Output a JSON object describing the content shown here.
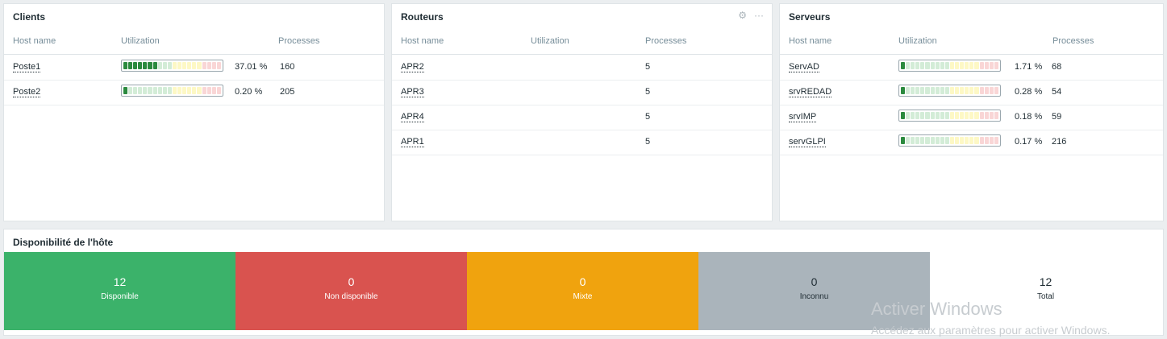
{
  "colors": {
    "available": "#3bb26a",
    "unavailable": "#d9534f",
    "mixed": "#f0a30e",
    "unknown": "#aab4bb",
    "seg_green_on": "#2b8a3e",
    "seg_green_off": "#d3ecd7",
    "seg_yellow_on": "#f0d64e",
    "seg_yellow_off": "#fdf8c5",
    "seg_red_on": "#e05252",
    "seg_red_off": "#f9d6d6"
  },
  "clients": {
    "title": "Clients",
    "col_host": "Host name",
    "col_util": "Utilization",
    "col_proc": "Processes",
    "rows": [
      {
        "host": "Poste1",
        "util_text": "37.01 %",
        "util": 0.3701,
        "proc": "160"
      },
      {
        "host": "Poste2",
        "util_text": "0.20 %",
        "util": 0.002,
        "proc": "205"
      }
    ]
  },
  "routeurs": {
    "title": "Routeurs",
    "gear_icon": "gear-icon",
    "menu_icon": "more-icon",
    "col_host": "Host name",
    "col_util": "Utilization",
    "col_proc": "Processes",
    "rows": [
      {
        "host": "APR2",
        "proc": "5"
      },
      {
        "host": "APR3",
        "proc": "5"
      },
      {
        "host": "APR4",
        "proc": "5"
      },
      {
        "host": "APR1",
        "proc": "5"
      }
    ]
  },
  "serveurs": {
    "title": "Serveurs",
    "col_host": "Host name",
    "col_util": "Utilization",
    "col_proc": "Processes",
    "rows": [
      {
        "host": "ServAD",
        "util_text": "1.71 %",
        "util": 0.0171,
        "proc": "68"
      },
      {
        "host": "srvREDAD",
        "util_text": "0.28 %",
        "util": 0.0028,
        "proc": "54"
      },
      {
        "host": "srvIMP",
        "util_text": "0.18 %",
        "util": 0.0018,
        "proc": "59"
      },
      {
        "host": "servGLPI",
        "util_text": "0.17 %",
        "util": 0.0017,
        "proc": "216"
      }
    ]
  },
  "availability": {
    "title": "Disponibilité de l'hôte",
    "items": [
      {
        "count": "12",
        "label": "Disponible"
      },
      {
        "count": "0",
        "label": "Non disponible"
      },
      {
        "count": "0",
        "label": "Mixte"
      },
      {
        "count": "0",
        "label": "Inconnu"
      },
      {
        "count": "12",
        "label": "Total"
      }
    ]
  },
  "watermark": {
    "line1": "Activer Windows",
    "line2": "Accédez aux paramètres pour activer Windows."
  }
}
